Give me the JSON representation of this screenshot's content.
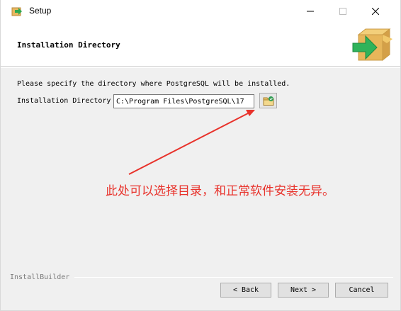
{
  "window": {
    "title": "Setup"
  },
  "header": {
    "heading": "Installation Directory",
    "logo_icon": "box-arrow-icon"
  },
  "body": {
    "instruction": "Please specify the directory where PostgreSQL will be installed.",
    "field_label": "Installation Directory",
    "field_value": "C:\\Program Files\\PostgreSQL\\17",
    "browse_icon": "folder-browse-icon"
  },
  "annotation": {
    "text": "此处可以选择目录，和正常软件安装无异。",
    "color": "#e8322b"
  },
  "footer": {
    "brand": "InstallBuilder",
    "back_label": "< Back",
    "next_label": "Next >",
    "cancel_label": "Cancel"
  }
}
